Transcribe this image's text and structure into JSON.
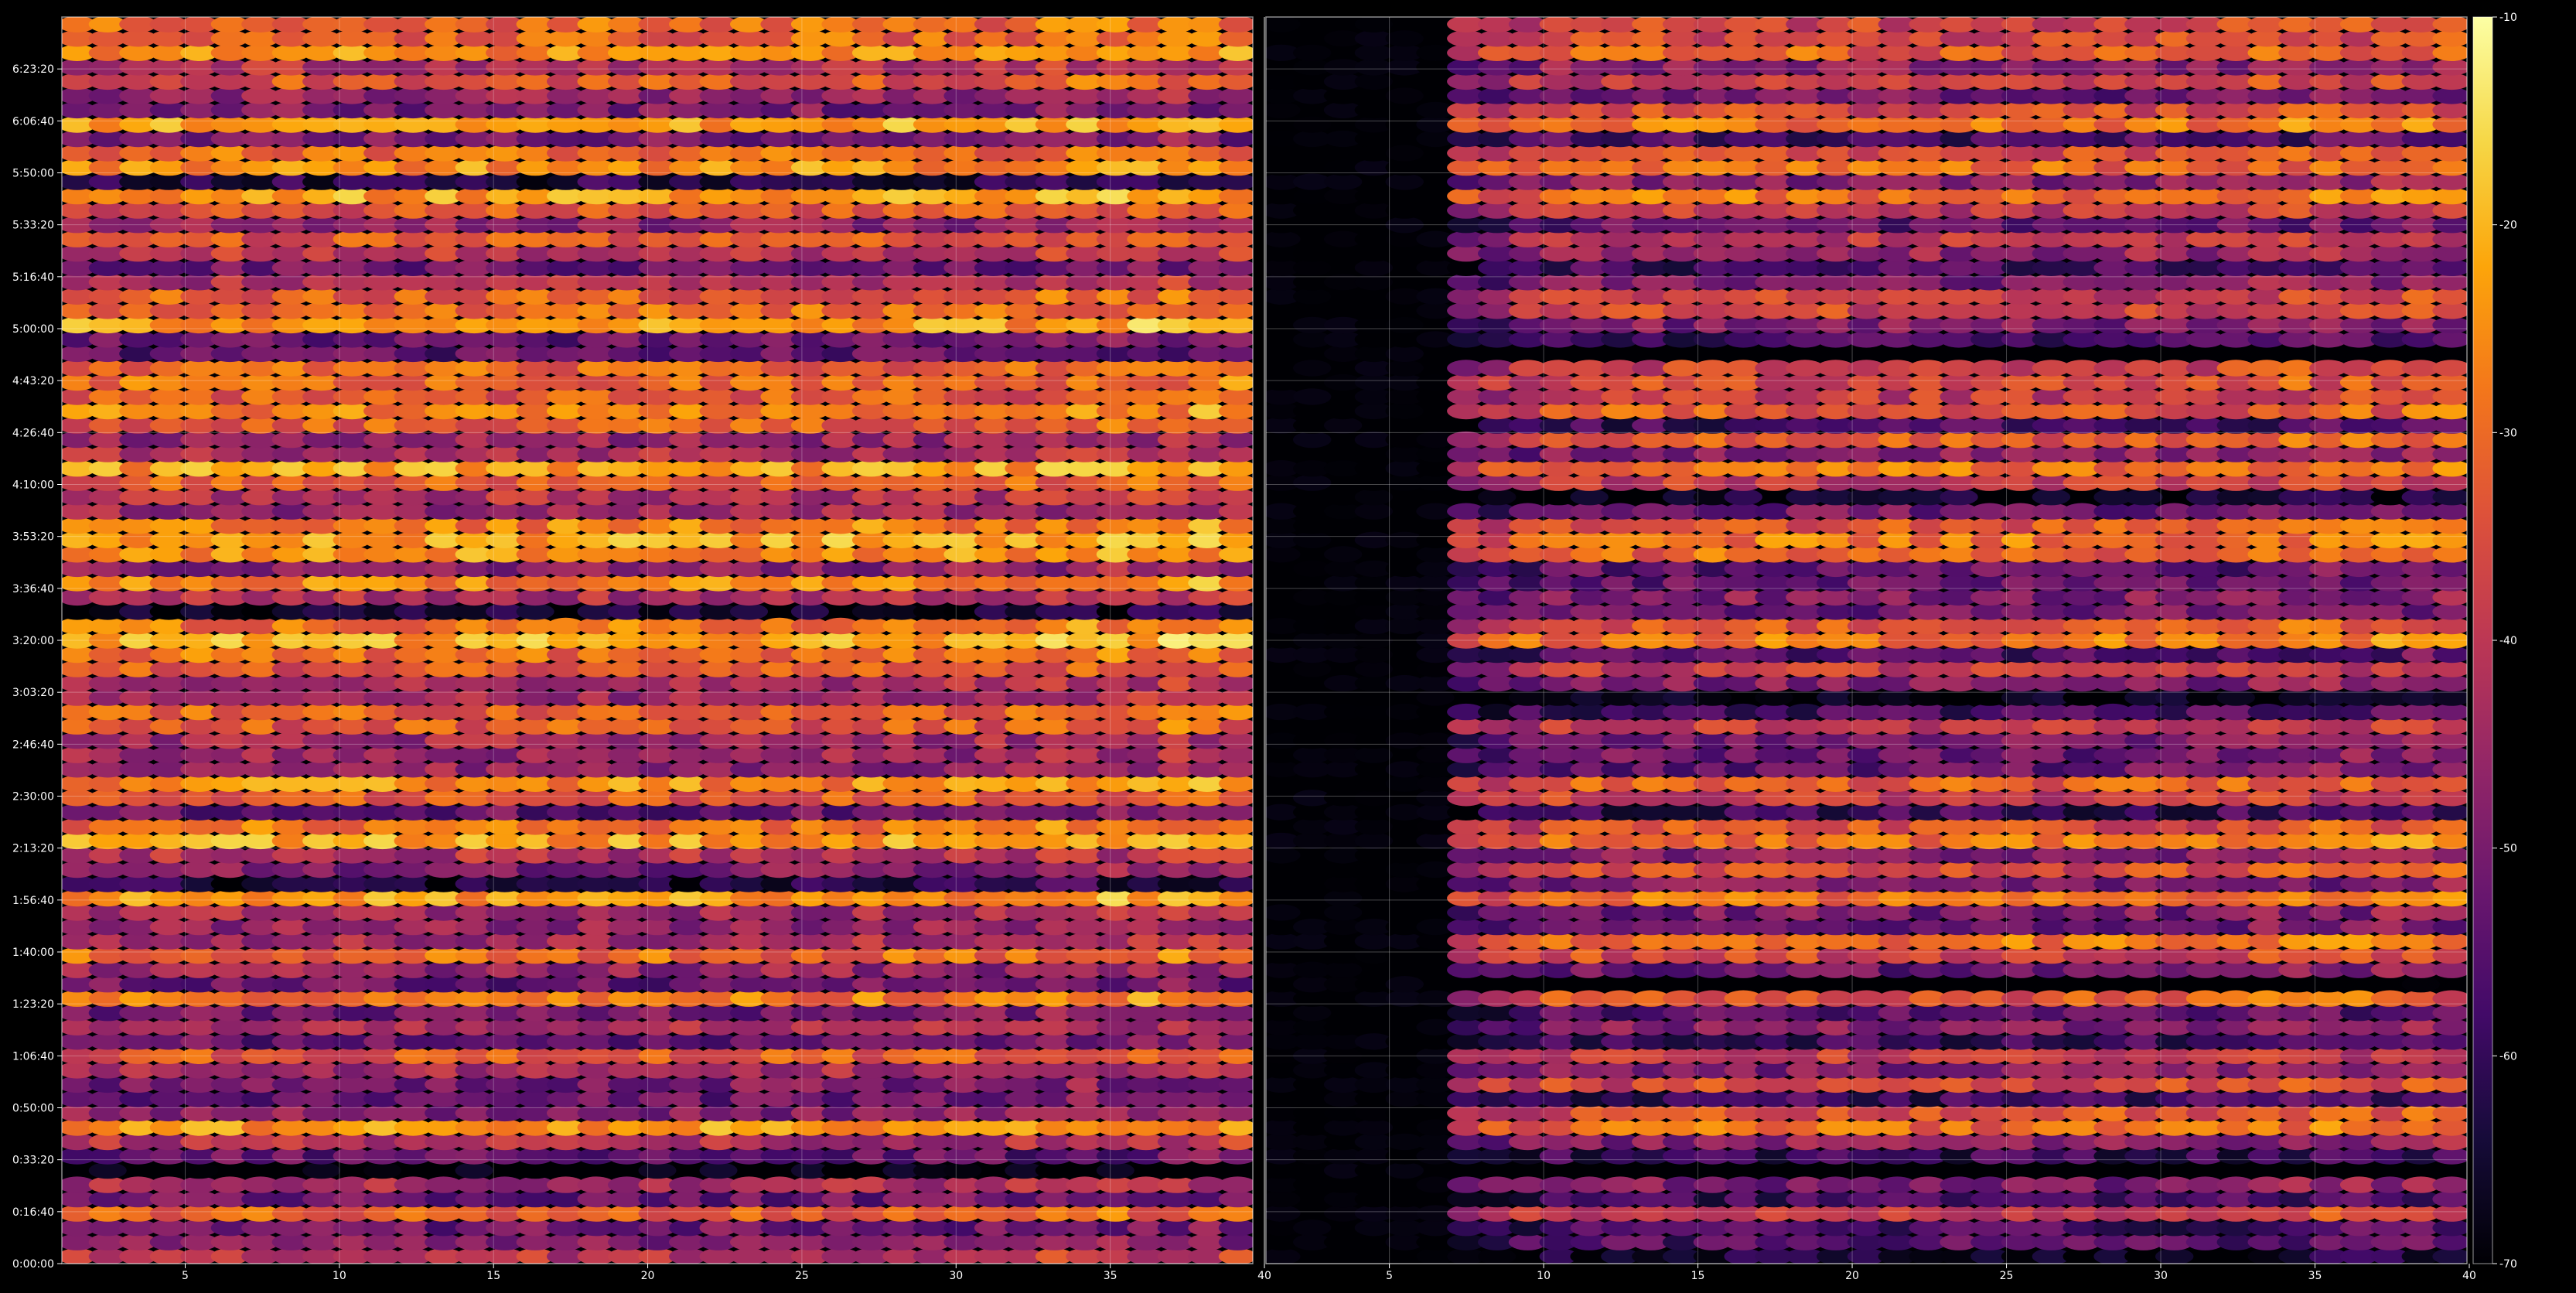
{
  "chart_data": {
    "type": "heatmap",
    "title": "",
    "xlabel": "",
    "ylabel": "",
    "panels": [
      {
        "name": "",
        "xlim": [
          1,
          40
        ],
        "x_ticks": [
          5,
          10,
          15,
          20,
          25,
          30,
          35,
          40
        ]
      },
      {
        "name": "",
        "xlim": [
          1,
          40
        ],
        "x_ticks": [
          5,
          10,
          15,
          20,
          25,
          30,
          35,
          40
        ]
      }
    ],
    "x_tick_labels": [
      "5",
      "10",
      "15",
      "20",
      "25",
      "30",
      "35",
      "40"
    ],
    "y_tick_labels": [
      "0:00:00",
      "0:16:40",
      "0:33:20",
      "0:50:00",
      "1:06:40",
      "1:23:20",
      "1:40:00",
      "1:56:40",
      "2:13:20",
      "2:30:00",
      "2:46:40",
      "3:03:20",
      "3:20:00",
      "3:36:40",
      "3:53:20",
      "4:10:00",
      "4:26:40",
      "4:43:20",
      "5:00:00",
      "5:16:40",
      "5:33:20",
      "5:50:00",
      "6:06:40",
      "6:23:20"
    ],
    "y_tick_seconds": [
      0,
      1000,
      2000,
      3000,
      4000,
      5000,
      6000,
      7000,
      8000,
      9000,
      10000,
      11000,
      12000,
      13000,
      14000,
      15000,
      16000,
      17000,
      18000,
      19000,
      20000,
      21000,
      22000,
      23000
    ],
    "ylim_seconds": [
      0,
      24000
    ],
    "colorbar": {
      "colormap": "inferno",
      "range": [
        -70,
        -10
      ],
      "ticks": [
        -70,
        -60,
        -50,
        -40,
        -30,
        -20,
        -10
      ],
      "tick_labels": [
        "-70",
        "-60",
        "-50",
        "-40",
        "-30",
        "-20",
        "-10"
      ]
    },
    "grid": true,
    "cells": {
      "columns": 39,
      "rows": 87
    },
    "bright_row_times_seconds": [
      1000,
      2600,
      2800,
      3000,
      3500,
      4000,
      5000,
      6000,
      6200,
      7000,
      7500,
      8300,
      9000,
      9200,
      10500,
      11400,
      11600,
      12000,
      12200,
      13200,
      13800,
      14200,
      15000,
      15300,
      15800,
      16000,
      16300,
      16800,
      17100,
      18000,
      18300,
      18600,
      19700,
      20200,
      20600,
      21000,
      21300,
      22000,
      22300,
      22800,
      23400,
      23700
    ],
    "band_level_db": {
      "min": -62,
      "max": -22
    },
    "right_panel_quiet_region": {
      "x_range": [
        1,
        6
      ],
      "level_db": -72
    }
  }
}
